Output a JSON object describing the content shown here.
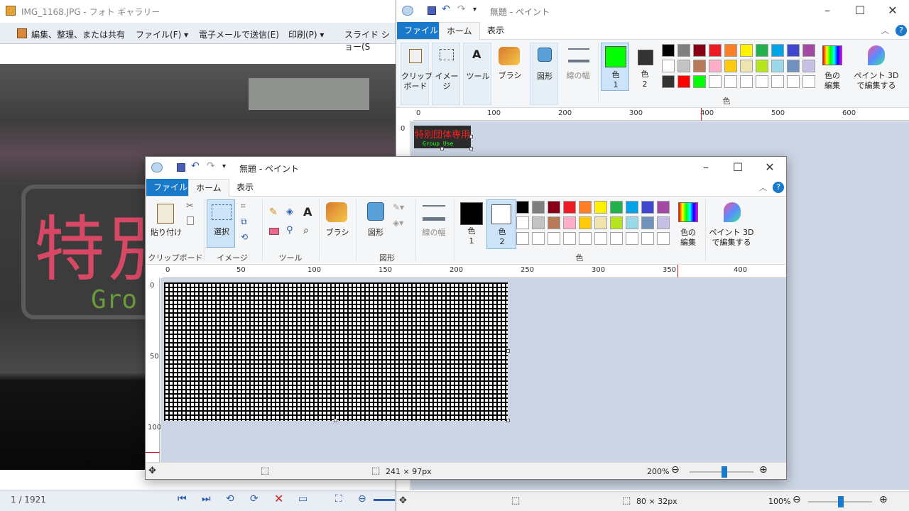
{
  "photos": {
    "title": "IMG_1168.JPG - フォト ギャラリー",
    "toolbar": [
      "編集、整理、または共有",
      "ファイル(F)",
      "電子メールで送信(E)",
      "印刷(P)",
      "スライド ショー(S"
    ],
    "counter": "1 / 1921",
    "sign_text": "特別",
    "sign_sub": "Gro"
  },
  "paint_back": {
    "title": "無題 - ペイント",
    "tabs": {
      "file": "ファイル",
      "home": "ホーム",
      "view": "表示"
    },
    "tools": {
      "clipboard": "クリップ\nボード",
      "image": "イメージ",
      "tools": "ツール",
      "brush": "ブラシ",
      "shapes": "図形",
      "size": "線の幅",
      "color1": "色\n1",
      "color2": "色\n2",
      "edit_colors": "色の\n編集",
      "paint3d": "ペイント 3D\nで編集する"
    },
    "color_group": "色",
    "ruler_h": [
      "0",
      "100",
      "200",
      "300",
      "400",
      "500",
      "600"
    ],
    "ruler_v": [
      "0"
    ],
    "canvas_text": "特別団体専用",
    "canvas_sub": "Group Use",
    "size": "80 × 32px",
    "zoom": "100%",
    "color1": "#00ff00",
    "color2": "#333333"
  },
  "paint_front": {
    "title": "無題 - ペイント",
    "tabs": {
      "file": "ファイル",
      "home": "ホーム",
      "view": "表示"
    },
    "tools": {
      "paste": "貼り付け",
      "select": "選択",
      "brush": "ブラシ",
      "shapes": "図形",
      "size": "線の幅",
      "color1": "色\n1",
      "color2": "色\n2",
      "edit_colors": "色の\n編集",
      "paint3d": "ペイント 3D\nで編集する"
    },
    "groups": {
      "clipboard": "クリップボード",
      "image": "イメージ",
      "tools": "ツール",
      "shapes": "図形",
      "colors": "色"
    },
    "ruler_h": [
      "0",
      "50",
      "100",
      "150",
      "200",
      "250",
      "300",
      "350",
      "400"
    ],
    "ruler_v": [
      "0",
      "50",
      "100"
    ],
    "size": "241 × 97px",
    "zoom": "200%",
    "color1": "#000000",
    "color2": "#ffffff"
  },
  "palette": {
    "row1": [
      "#000000",
      "#7f7f7f",
      "#880015",
      "#ed1c24",
      "#ff7f27",
      "#fff200",
      "#22b14c",
      "#00a2e8",
      "#3f48cc",
      "#a349a4"
    ],
    "row2": [
      "#ffffff",
      "#c3c3c3",
      "#b97a57",
      "#ffaec9",
      "#ffc90e",
      "#efe4b0",
      "#b5e61d",
      "#99d9ea",
      "#7092be",
      "#c8bfe7"
    ],
    "row3_back": [
      "#333333",
      "#ff0000",
      "#00ff00",
      "#ffffff",
      "#ffffff",
      "#ffffff",
      "#ffffff",
      "#ffffff",
      "#ffffff",
      "#ffffff"
    ],
    "row3_front": [
      "#ffffff",
      "#ffffff",
      "#ffffff",
      "#ffffff",
      "#ffffff",
      "#ffffff",
      "#ffffff",
      "#ffffff",
      "#ffffff",
      "#ffffff"
    ]
  }
}
